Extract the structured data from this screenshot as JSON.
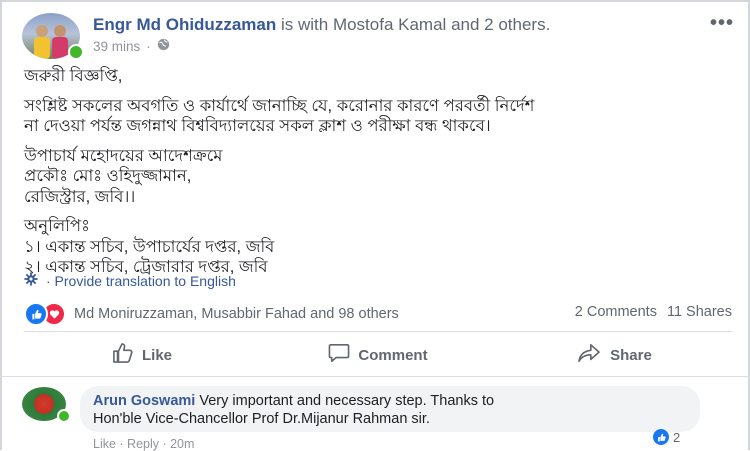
{
  "post": {
    "author": "Engr Md Ohiduzzaman",
    "with_text": "is with",
    "tagged_person": "Mostofa Kamal",
    "and_text": "and",
    "others_link": "2 others.",
    "time": "39 mins",
    "privacy_separator": "·",
    "more_label": "•••",
    "body_lines": [
      "জরুরী বিজ্ঞপ্তি,",
      "",
      "সংশ্লিষ্ট সকলের অবগতি ও কার্যার্থে জানাচ্ছি যে, করোনার কারণে পরবর্তী নির্দেশ",
      "না দেওয়া পর্যন্ত জগন্নাথ বিশ্ববিদ্যালয়ের সকল ক্লাশ ও পরীক্ষা বন্ধ থাকবে।",
      "",
      "উপাচার্য মহোদয়ের আদেশক্রমে",
      "প্রকৌঃ মোঃ ওহিদুজ্জামান,",
      "রেজিস্ট্রার, জবি।।",
      "",
      "অনুলিপিঃ",
      "১। একান্ত সচিব, উপাচার্যের দপ্তর, জবি",
      "২। একান্ত সচিব, ট্রেজারার দপ্তর, জবি"
    ],
    "translate_link": "· Provide translation to English"
  },
  "reactions": {
    "names": "Md Moniruzzaman, Musabbir Fahad and 98 others",
    "comments": "2 Comments",
    "shares": "11 Shares"
  },
  "actions": {
    "like": "Like",
    "comment": "Comment",
    "share": "Share"
  },
  "comment": {
    "author": "Arun Goswami",
    "text_line1": "Very important and necessary step. Thanks to",
    "text_line2": "Hon'ble Vice-Chancellor Prof Dr.Mijanur Rahman sir.",
    "reaction_count": "2",
    "meta": "Like · Reply · 20m"
  },
  "colors": {
    "link": "#385898",
    "like_blue": "#1877f2",
    "love_red": "#f0284a",
    "online_green": "#42b72a"
  },
  "icons": [
    "globe-icon",
    "gear-icon",
    "like-reaction-icon",
    "love-reaction-icon",
    "thumbs-up-icon",
    "comment-icon",
    "share-icon",
    "more-icon"
  ]
}
